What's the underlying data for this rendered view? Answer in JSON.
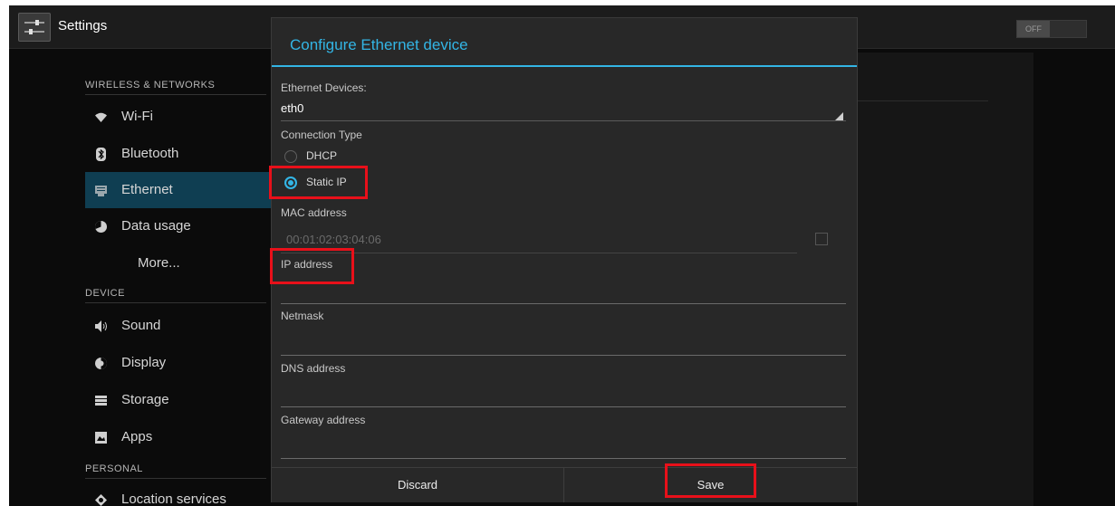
{
  "app": {
    "title": "Settings",
    "toggle_label": "OFF"
  },
  "sidebar": {
    "sections": [
      {
        "header": "WIRELESS & NETWORKS"
      },
      {
        "header": "DEVICE"
      },
      {
        "header": "PERSONAL"
      }
    ],
    "items": [
      {
        "label": "Wi-Fi",
        "icon": "wifi-icon"
      },
      {
        "label": "Bluetooth",
        "icon": "bluetooth-icon"
      },
      {
        "label": "Ethernet",
        "icon": "ethernet-icon",
        "selected": true
      },
      {
        "label": "Data usage",
        "icon": "data-usage-icon"
      },
      {
        "label": "More..."
      },
      {
        "label": "Sound",
        "icon": "sound-icon"
      },
      {
        "label": "Display",
        "icon": "display-icon"
      },
      {
        "label": "Storage",
        "icon": "storage-icon"
      },
      {
        "label": "Apps",
        "icon": "apps-icon"
      },
      {
        "label": "Location services",
        "icon": "location-icon"
      }
    ]
  },
  "dialog": {
    "title": "Configure Ethernet device",
    "devices_label": "Ethernet Devices:",
    "device_value": "eth0",
    "connection_type_label": "Connection Type",
    "options": [
      {
        "label": "DHCP",
        "selected": false
      },
      {
        "label": "Static IP",
        "selected": true
      }
    ],
    "mac_label": "MAC address",
    "mac_value": "00:01:02:03:04:06",
    "ip_label": "IP address",
    "netmask_label": "Netmask",
    "dns_label": "DNS address",
    "gateway_label": "Gateway address",
    "discard_label": "Discard",
    "save_label": "Save"
  },
  "colors": {
    "accent": "#33b5e5",
    "selected_bg": "#0f3e52",
    "highlight": "#e8101a"
  }
}
